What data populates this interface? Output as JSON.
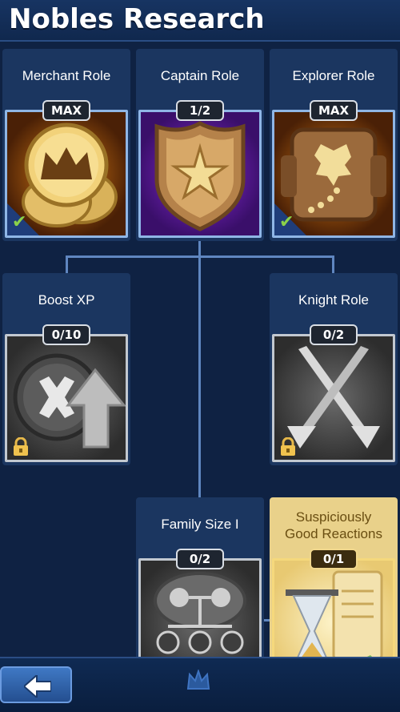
{
  "header": {
    "title": "Nobles Research"
  },
  "cards": {
    "merchant": {
      "title": "Merchant Role",
      "badge": "MAX",
      "icon": "coins-crown-icon"
    },
    "captain": {
      "title": "Captain Role",
      "badge": "1/2",
      "icon": "sheriff-badge-icon"
    },
    "explorer": {
      "title": "Explorer Role",
      "badge": "MAX",
      "icon": "treasure-map-icon"
    },
    "boost": {
      "title": "Boost XP",
      "badge": "0/10",
      "icon": "xp-boost-icon"
    },
    "knight": {
      "title": "Knight Role",
      "badge": "0/2",
      "icon": "crossed-swords-icon"
    },
    "family": {
      "title": "Family Size I",
      "badge": "0/2",
      "icon": "family-tree-icon"
    },
    "reactions": {
      "title_line1": "Suspiciously",
      "title_line2": "Good Reactions",
      "badge": "0/1",
      "icon": "hourglass-scroll-icon"
    }
  },
  "footer": {
    "back_icon": "back-arrow-icon",
    "center_icon": "crown-icon"
  },
  "colors": {
    "header_bg": "#173462",
    "card_bg": "#1b3660",
    "special_card_bg": "#e9d18a",
    "connector": "#5f86c0",
    "check": "#8ad14a"
  }
}
